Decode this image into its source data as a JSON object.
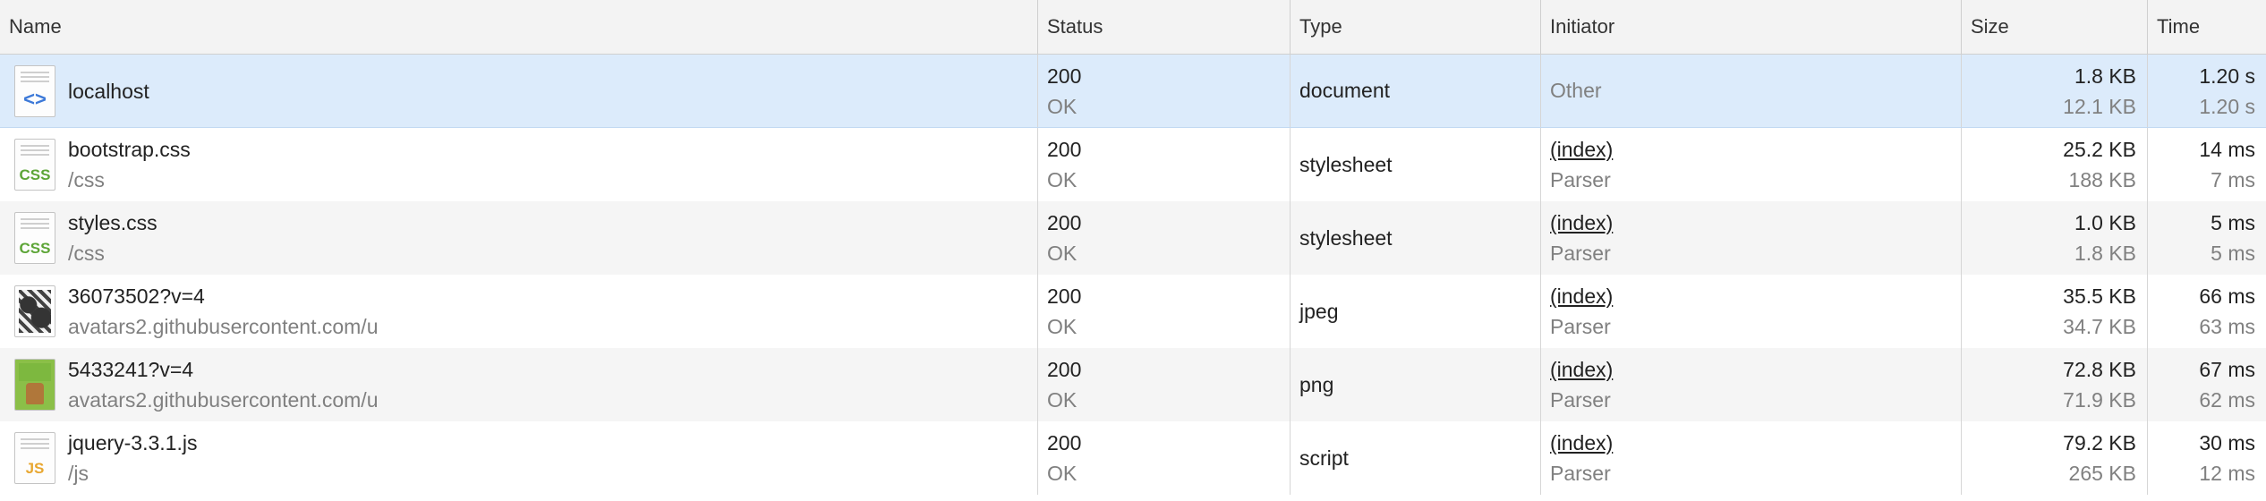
{
  "columns": {
    "name": "Name",
    "status": "Status",
    "type": "Type",
    "initiator": "Initiator",
    "size": "Size",
    "time": "Time"
  },
  "rows": [
    {
      "icon": "html-document-icon",
      "name": "localhost",
      "path": "",
      "status_code": "200",
      "status_text": "OK",
      "type": "document",
      "initiator": "Other",
      "initiator_detail": "",
      "size": "1.8 KB",
      "size_resource": "12.1 KB",
      "time": "1.20 s",
      "time_latency": "1.20 s"
    },
    {
      "icon": "css-file-icon",
      "name": "bootstrap.css",
      "path": "/css",
      "status_code": "200",
      "status_text": "OK",
      "type": "stylesheet",
      "initiator": "(index)",
      "initiator_detail": "Parser",
      "size": "25.2 KB",
      "size_resource": "188 KB",
      "time": "14 ms",
      "time_latency": "7 ms"
    },
    {
      "icon": "css-file-icon",
      "name": "styles.css",
      "path": "/css",
      "status_code": "200",
      "status_text": "OK",
      "type": "stylesheet",
      "initiator": "(index)",
      "initiator_detail": "Parser",
      "size": "1.0 KB",
      "size_resource": "1.8 KB",
      "time": "5 ms",
      "time_latency": "5 ms"
    },
    {
      "icon": "image-thumbnail-icon",
      "name": "36073502?v=4",
      "path": "avatars2.githubusercontent.com/u",
      "status_code": "200",
      "status_text": "OK",
      "type": "jpeg",
      "initiator": "(index)",
      "initiator_detail": "Parser",
      "size": "35.5 KB",
      "size_resource": "34.7 KB",
      "time": "66 ms",
      "time_latency": "63 ms"
    },
    {
      "icon": "image-thumbnail-icon",
      "name": "5433241?v=4",
      "path": "avatars2.githubusercontent.com/u",
      "status_code": "200",
      "status_text": "OK",
      "type": "png",
      "initiator": "(index)",
      "initiator_detail": "Parser",
      "size": "72.8 KB",
      "size_resource": "71.9 KB",
      "time": "67 ms",
      "time_latency": "62 ms"
    },
    {
      "icon": "js-file-icon",
      "name": "jquery-3.3.1.js",
      "path": "/js",
      "status_code": "200",
      "status_text": "OK",
      "type": "script",
      "initiator": "(index)",
      "initiator_detail": "Parser",
      "size": "79.2 KB",
      "size_resource": "265 KB",
      "time": "30 ms",
      "time_latency": "12 ms"
    }
  ]
}
